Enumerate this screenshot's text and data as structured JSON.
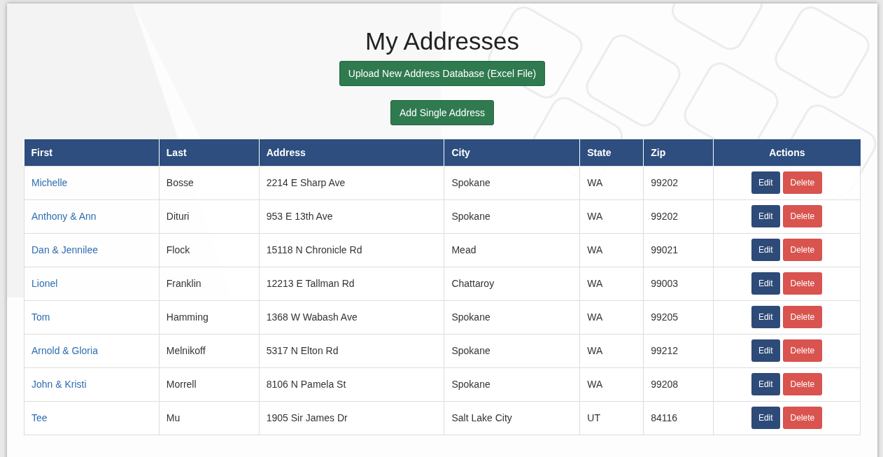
{
  "title": "My Addresses",
  "buttons": [
    {
      "label": "Upload New Address Database (Excel File)"
    },
    {
      "label": "Add Single Address"
    }
  ],
  "table": {
    "columns": [
      "First",
      "Last",
      "Address",
      "City",
      "State",
      "Zip",
      "Actions"
    ],
    "rows": [
      {
        "first": "Michelle",
        "last": "Bosse",
        "address": "2214 E Sharp Ave",
        "city": "Spokane",
        "state": "WA",
        "zip": "99202",
        "actions": [
          "Edit",
          "Delete"
        ]
      },
      {
        "first": "Anthony & Ann",
        "last": "Dituri",
        "address": "953 E 13th Ave",
        "city": "Spokane",
        "state": "WA",
        "zip": "99202",
        "actions": [
          "Edit",
          "Delete"
        ]
      },
      {
        "first": "Dan & Jennilee",
        "last": "Flock",
        "address": "15118 N Chronicle Rd",
        "city": "Mead",
        "state": "WA",
        "zip": "99021",
        "actions": [
          "Edit",
          "Delete"
        ]
      },
      {
        "first": "Lionel",
        "last": "Franklin",
        "address": "12213 E Tallman Rd",
        "city": "Chattaroy",
        "state": "WA",
        "zip": "99003",
        "actions": [
          "Edit",
          "Delete"
        ]
      },
      {
        "first": "Tom",
        "last": "Hamming",
        "address": "1368 W Wabash Ave",
        "city": "Spokane",
        "state": "WA",
        "zip": "99205",
        "actions": [
          "Edit",
          "Delete"
        ]
      },
      {
        "first": "Arnold & Gloria",
        "last": "Melnikoff",
        "address": "5317 N Elton Rd",
        "city": "Spokane",
        "state": "WA",
        "zip": "99212",
        "actions": [
          "Edit",
          "Delete"
        ]
      },
      {
        "first": "John & Kristi",
        "last": "Morrell",
        "address": "8106 N Pamela St",
        "city": "Spokane",
        "state": "WA",
        "zip": "99208",
        "actions": [
          "Edit",
          "Delete"
        ]
      },
      {
        "first": "Tee",
        "last": "Mu",
        "address": "1905 Sir James Dr",
        "city": "Salt Lake City",
        "state": "UT",
        "zip": "84116",
        "actions": [
          "Edit",
          "Delete"
        ]
      }
    ]
  }
}
